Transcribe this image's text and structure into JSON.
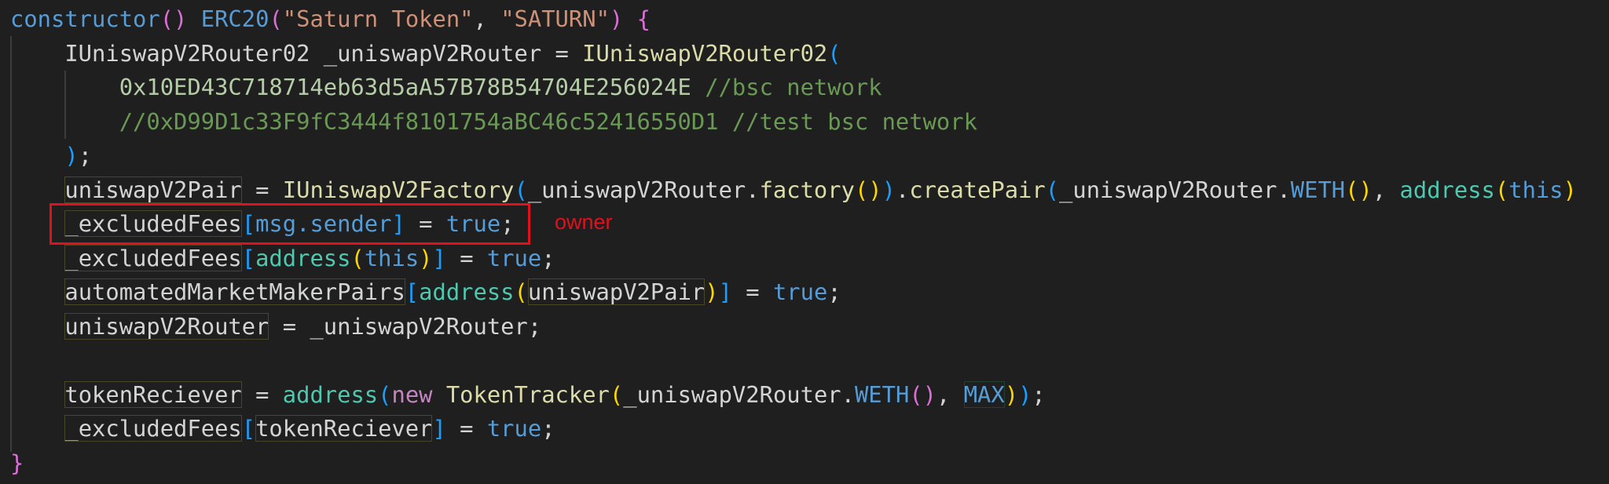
{
  "annotation": {
    "label": "owner",
    "color": "#e3101b"
  },
  "colors": {
    "background": "#1f1f1f",
    "keyword": "#569cd6",
    "string": "#ce9178",
    "function": "#dcdcaa",
    "number": "#b5cea8",
    "comment": "#6a9955",
    "type": "#4ec9b0"
  },
  "code": {
    "language": "solidity",
    "lines": [
      [
        [
          "constructor",
          "kw"
        ],
        [
          "()",
          "b1"
        ],
        [
          " ",
          "plain"
        ],
        [
          "ERC20",
          "kw"
        ],
        [
          "(",
          "b1"
        ],
        [
          "\"Saturn Token\"",
          "str"
        ],
        [
          ", ",
          "plain"
        ],
        [
          "\"SATURN\"",
          "str"
        ],
        [
          ")",
          "b1"
        ],
        [
          " ",
          "plain"
        ],
        [
          "{",
          "b1"
        ]
      ],
      [
        [
          "    IUniswapV2Router02 _uniswapV2Router = ",
          "plain"
        ],
        [
          "IUniswapV2Router02",
          "fn"
        ],
        [
          "(",
          "b2"
        ]
      ],
      [
        [
          "        ",
          "plain"
        ],
        [
          "0x10ED43C718714eb63d5aA57B78B54704E256024E",
          "num"
        ],
        [
          " ",
          "plain"
        ],
        [
          "//bsc network",
          "cmt"
        ]
      ],
      [
        [
          "        ",
          "plain"
        ],
        [
          "//0xD99D1c33F9fC3444f8101754aBC46c52416550D1 //test bsc network",
          "cmt"
        ]
      ],
      [
        [
          "    ",
          "plain"
        ],
        [
          ")",
          "b2"
        ],
        [
          ";",
          "plain"
        ]
      ],
      [
        [
          "    ",
          "plain"
        ],
        [
          "uniswapV2Pair",
          "plain",
          "hl"
        ],
        [
          " = ",
          "plain"
        ],
        [
          "IUniswapV2Factory",
          "fn"
        ],
        [
          "(",
          "b2"
        ],
        [
          "_uniswapV2Router.",
          "plain"
        ],
        [
          "factory",
          "fn"
        ],
        [
          "()",
          "b3"
        ],
        [
          ")",
          "b2"
        ],
        [
          ".",
          "plain"
        ],
        [
          "createPair",
          "fn"
        ],
        [
          "(",
          "b2"
        ],
        [
          "_uniswapV2Router.",
          "plain"
        ],
        [
          "WETH",
          "kw"
        ],
        [
          "()",
          "b3"
        ],
        [
          ", ",
          "plain"
        ],
        [
          "address",
          "type"
        ],
        [
          "(",
          "b3"
        ],
        [
          "this",
          "kw"
        ],
        [
          ")",
          "b3"
        ]
      ],
      [
        [
          "    ",
          "plain"
        ],
        [
          "_excludedFees",
          "plain",
          "hl"
        ],
        [
          "[",
          "b2"
        ],
        [
          "msg.sender",
          "kw"
        ],
        [
          "]",
          "b2"
        ],
        [
          " = ",
          "plain"
        ],
        [
          "true",
          "kw"
        ],
        [
          ";",
          "plain"
        ]
      ],
      [
        [
          "    ",
          "plain"
        ],
        [
          "_excludedFees",
          "plain",
          "hl"
        ],
        [
          "[",
          "b2"
        ],
        [
          "address",
          "type"
        ],
        [
          "(",
          "b3"
        ],
        [
          "this",
          "kw"
        ],
        [
          ")",
          "b3"
        ],
        [
          "]",
          "b2"
        ],
        [
          " = ",
          "plain"
        ],
        [
          "true",
          "kw"
        ],
        [
          ";",
          "plain"
        ]
      ],
      [
        [
          "    ",
          "plain"
        ],
        [
          "automatedMarketMakerPairs",
          "plain",
          "hl"
        ],
        [
          "[",
          "b2"
        ],
        [
          "address",
          "type"
        ],
        [
          "(",
          "b3"
        ],
        [
          "uniswapV2Pair",
          "plain",
          "hl"
        ],
        [
          ")",
          "b3"
        ],
        [
          "]",
          "b2"
        ],
        [
          " = ",
          "plain"
        ],
        [
          "true",
          "kw"
        ],
        [
          ";",
          "plain"
        ]
      ],
      [
        [
          "    ",
          "plain"
        ],
        [
          "uniswapV2Router",
          "plain",
          "hl"
        ],
        [
          " = _uniswapV2Router;",
          "plain"
        ]
      ],
      [],
      [
        [
          "    ",
          "plain"
        ],
        [
          "tokenReciever",
          "plain",
          "hl"
        ],
        [
          " = ",
          "plain"
        ],
        [
          "address",
          "type"
        ],
        [
          "(",
          "b2"
        ],
        [
          "new",
          "ctl"
        ],
        [
          " ",
          "plain"
        ],
        [
          "TokenTracker",
          "fn"
        ],
        [
          "(",
          "b3"
        ],
        [
          "_uniswapV2Router.",
          "plain"
        ],
        [
          "WETH",
          "kw"
        ],
        [
          "()",
          "b1"
        ],
        [
          ", ",
          "plain"
        ],
        [
          "MAX",
          "kw",
          "hlg"
        ],
        [
          ")",
          "b3"
        ],
        [
          ")",
          "b2"
        ],
        [
          ";",
          "plain"
        ]
      ],
      [
        [
          "    ",
          "plain"
        ],
        [
          "_excludedFees",
          "plain",
          "hl"
        ],
        [
          "[",
          "b2"
        ],
        [
          "tokenReciever",
          "plain",
          "hl"
        ],
        [
          "]",
          "b2"
        ],
        [
          " = ",
          "plain"
        ],
        [
          "true",
          "kw"
        ],
        [
          ";",
          "plain"
        ]
      ],
      [
        [
          "}",
          "b1"
        ]
      ]
    ]
  }
}
